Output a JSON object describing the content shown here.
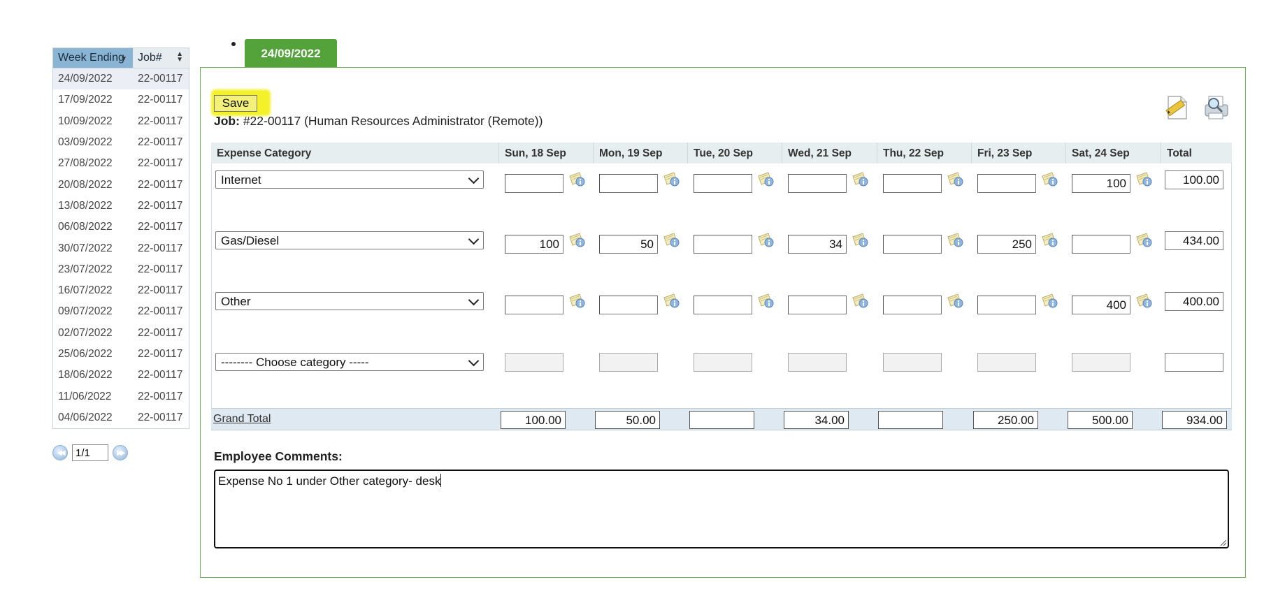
{
  "week_list": {
    "headers": {
      "week_ending": "Week Ending",
      "job": "Job#"
    },
    "rows": [
      {
        "week": "24/09/2022",
        "job": "22-00117"
      },
      {
        "week": "17/09/2022",
        "job": "22-00117"
      },
      {
        "week": "10/09/2022",
        "job": "22-00117"
      },
      {
        "week": "03/09/2022",
        "job": "22-00117"
      },
      {
        "week": "27/08/2022",
        "job": "22-00117"
      },
      {
        "week": "20/08/2022",
        "job": "22-00117"
      },
      {
        "week": "13/08/2022",
        "job": "22-00117"
      },
      {
        "week": "06/08/2022",
        "job": "22-00117"
      },
      {
        "week": "30/07/2022",
        "job": "22-00117"
      },
      {
        "week": "23/07/2022",
        "job": "22-00117"
      },
      {
        "week": "16/07/2022",
        "job": "22-00117"
      },
      {
        "week": "09/07/2022",
        "job": "22-00117"
      },
      {
        "week": "02/07/2022",
        "job": "22-00117"
      },
      {
        "week": "25/06/2022",
        "job": "22-00117"
      },
      {
        "week": "18/06/2022",
        "job": "22-00117"
      },
      {
        "week": "11/06/2022",
        "job": "22-00117"
      },
      {
        "week": "04/06/2022",
        "job": "22-00117"
      }
    ],
    "pager_value": "1/1"
  },
  "tab": {
    "label": "24/09/2022"
  },
  "toolbar": {
    "save_label": "Save"
  },
  "job": {
    "label": "Job:",
    "value": "#22-00117 (Human Resources Administrator (Remote))"
  },
  "grid": {
    "headers": [
      "Expense Category",
      "Sun, 18 Sep",
      "Mon, 19 Sep",
      "Tue, 20 Sep",
      "Wed, 21 Sep",
      "Thu, 22 Sep",
      "Fri, 23 Sep",
      "Sat, 24 Sep",
      "Total"
    ],
    "rows": [
      {
        "category": "Internet",
        "values": [
          "",
          "",
          "",
          "",
          "",
          "",
          "100"
        ],
        "total": "100.00"
      },
      {
        "category": "Gas/Diesel",
        "values": [
          "100",
          "50",
          "",
          "34",
          "",
          "250",
          ""
        ],
        "total": "434.00"
      },
      {
        "category": "Other",
        "values": [
          "",
          "",
          "",
          "",
          "",
          "",
          "400"
        ],
        "total": "400.00"
      },
      {
        "category": "-------- Choose category -----",
        "values": [
          "",
          "",
          "",
          "",
          "",
          "",
          ""
        ],
        "total": ""
      }
    ],
    "grand_total_label": "Grand Total",
    "grand_totals": [
      "100.00",
      "50.00",
      "",
      "34.00",
      "",
      "250.00",
      "500.00",
      "934.00"
    ]
  },
  "comments": {
    "label": "Employee Comments:",
    "value": "Expense No 1 under Other category- desk"
  },
  "colors": {
    "tab_green": "#53a23a",
    "panel_border": "#6fb35a",
    "save_highlight": "#f4f12a",
    "sort_header": "#8ab4d4"
  },
  "icons": [
    "note-icon",
    "edit-icon",
    "print-preview-icon",
    "first-page-icon",
    "next-page-icon",
    "sort-icon"
  ]
}
